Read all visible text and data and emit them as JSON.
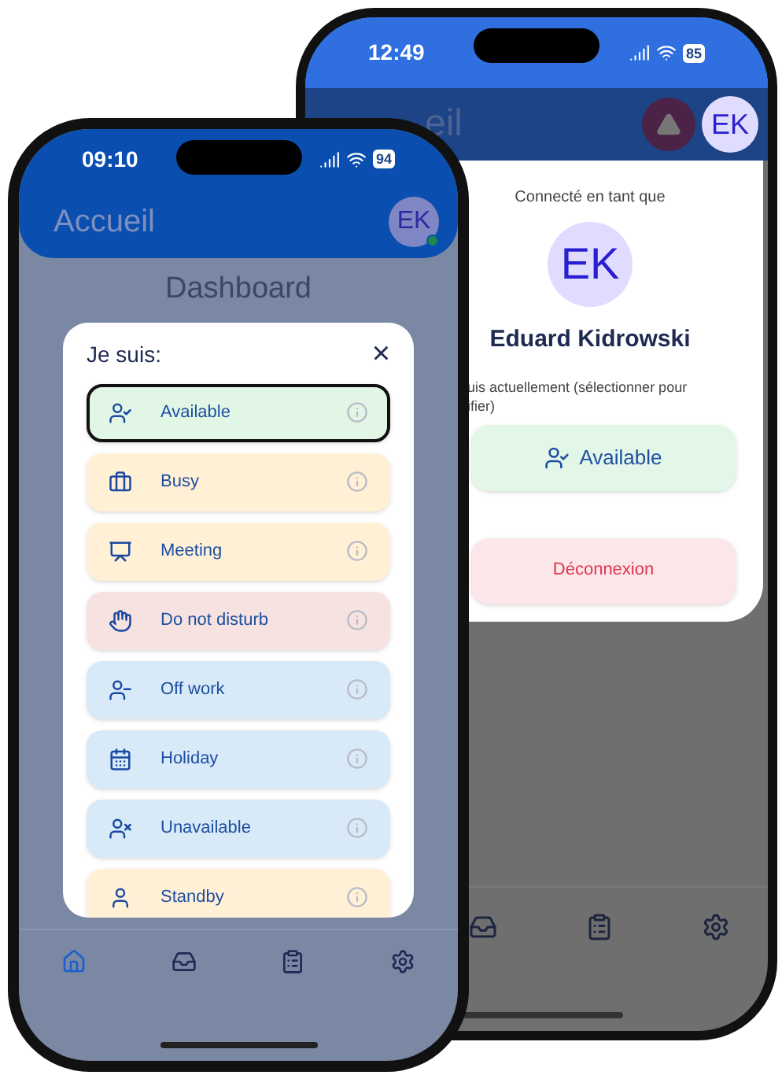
{
  "back_phone": {
    "status_bar": {
      "time": "12:49",
      "battery": "85"
    },
    "header": {
      "title": "eil",
      "avatar": "EK"
    },
    "account_sheet": {
      "caption": "Connecté en tant que",
      "avatar": "EK",
      "name": "Eduard Kidrowski",
      "status_hint": [
        "uis actuellement (sélectionner pour",
        "ifier)"
      ],
      "status_button": {
        "label": "Available",
        "color": "#e3f7e8"
      },
      "logout_button": "Déconnexion"
    },
    "tab_bar": [
      {
        "selected": false
      },
      {
        "selected": false
      },
      {
        "selected": false
      }
    ]
  },
  "front_phone": {
    "status_bar": {
      "time": "09:10",
      "battery": "94"
    },
    "header": {
      "title": "Accueil",
      "avatar": "EK",
      "online": true
    },
    "page_title": "Dashboard",
    "status_dialog": {
      "title": "Je suis:",
      "close": "×",
      "options": [
        {
          "label": "Available",
          "selected": true,
          "color": "#e2f6e6"
        },
        {
          "label": "Busy",
          "selected": false,
          "color": "#fff0d6"
        },
        {
          "label": "Meeting",
          "selected": false,
          "color": "#fff0d6"
        },
        {
          "label": "Do not disturb",
          "selected": false,
          "color": "#f7e2e2"
        },
        {
          "label": "Off work",
          "selected": false,
          "color": "#d8e9f8"
        },
        {
          "label": "Holiday",
          "selected": false,
          "color": "#d8e9f8"
        },
        {
          "label": "Unavailable",
          "selected": false,
          "color": "#d8e9f8"
        },
        {
          "label": "Standby",
          "selected": false,
          "color": "#fff0d6"
        }
      ]
    },
    "tab_bar": [
      {
        "selected": true
      },
      {
        "selected": false
      },
      {
        "selected": false
      },
      {
        "selected": false
      }
    ]
  }
}
